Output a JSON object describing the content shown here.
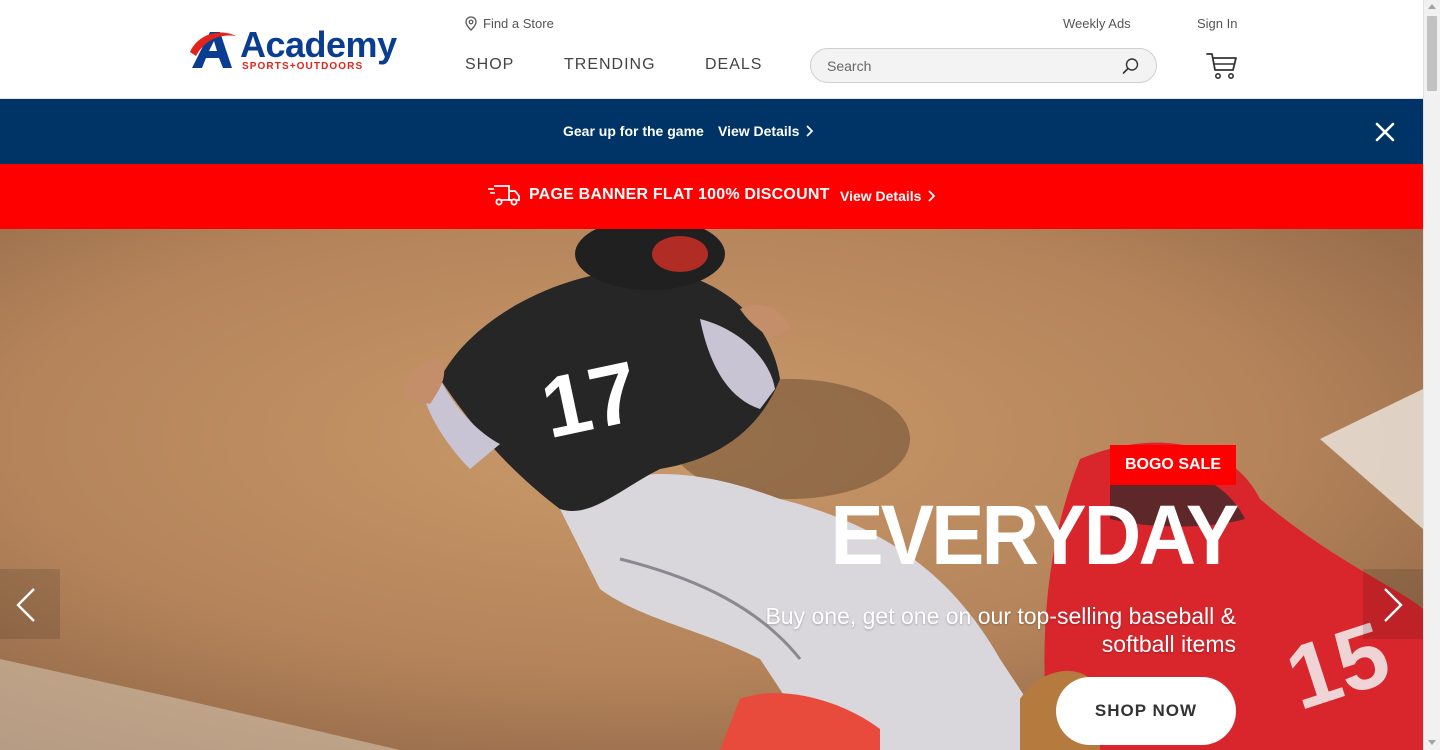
{
  "brand": {
    "name": "Academy",
    "tagline": "SPORTS+OUTDOORS",
    "primary_color": "#0a3d91",
    "accent_color": "#e2231a"
  },
  "header": {
    "find_store": {
      "label": "Find a Store",
      "icon": "map-pin-icon"
    },
    "weekly_ads": "Weekly Ads",
    "sign_in": "Sign In",
    "nav": [
      {
        "label": "SHOP"
      },
      {
        "label": "TRENDING"
      },
      {
        "label": "DEALS"
      }
    ],
    "search": {
      "placeholder": "Search",
      "icon": "search-icon"
    },
    "cart": {
      "icon": "cart-icon"
    }
  },
  "promo_banners": {
    "primary": {
      "text": "Gear up for the game",
      "link": "View Details",
      "background": "#003366",
      "close_icon": "close-icon"
    },
    "secondary": {
      "icon": "delivery-truck-icon",
      "text": "PAGE BANNER FLAT 100% DISCOUNT",
      "link": "View Details",
      "background": "#ff0000"
    }
  },
  "hero": {
    "badge": "BOGO SALE",
    "title": "EVERYDAY",
    "subtitle": "Buy one, get one on our top-selling baseball & softball items",
    "cta": "SHOP NOW",
    "jersey_number": "17",
    "prev_icon": "chevron-left-icon",
    "next_icon": "chevron-right-icon"
  }
}
